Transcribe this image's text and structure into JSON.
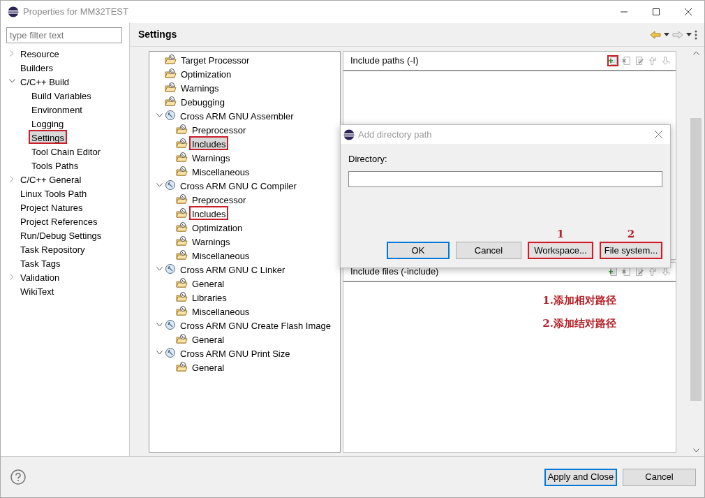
{
  "window": {
    "title": "Properties for MM32TEST"
  },
  "sidebar": {
    "filter_placeholder": "type filter text",
    "items": [
      {
        "label": "Resource",
        "expanded": false,
        "selected": false,
        "highlighted": false
      },
      {
        "label": "Builders",
        "selected": false,
        "highlighted": false
      },
      {
        "label": "C/C++ Build",
        "expanded": true,
        "selected": false,
        "highlighted": false,
        "children": [
          {
            "label": "Build Variables",
            "selected": false,
            "highlighted": false
          },
          {
            "label": "Environment",
            "selected": false,
            "highlighted": false
          },
          {
            "label": "Logging",
            "selected": false,
            "highlighted": false
          },
          {
            "label": "Settings",
            "selected": true,
            "highlighted": true
          },
          {
            "label": "Tool Chain Editor",
            "selected": false,
            "highlighted": false
          },
          {
            "label": "Tools Paths",
            "selected": false,
            "highlighted": false
          }
        ]
      },
      {
        "label": "C/C++ General",
        "expanded": false,
        "selected": false,
        "highlighted": false
      },
      {
        "label": "Linux Tools Path",
        "selected": false,
        "highlighted": false
      },
      {
        "label": "Project Natures",
        "selected": false,
        "highlighted": false
      },
      {
        "label": "Project References",
        "selected": false,
        "highlighted": false
      },
      {
        "label": "Run/Debug Settings",
        "selected": false,
        "highlighted": false
      },
      {
        "label": "Task Repository",
        "selected": false,
        "highlighted": false
      },
      {
        "label": "Task Tags",
        "selected": false,
        "highlighted": false
      },
      {
        "label": "Validation",
        "expanded": false,
        "selected": false,
        "highlighted": false
      },
      {
        "label": "WikiText",
        "selected": false,
        "highlighted": false
      }
    ]
  },
  "page": {
    "title": "Settings"
  },
  "tool_tree": [
    {
      "label": "Target Processor",
      "kind": "option",
      "selected": false,
      "highlighted": false
    },
    {
      "label": "Optimization",
      "kind": "option",
      "selected": false,
      "highlighted": false
    },
    {
      "label": "Warnings",
      "kind": "option",
      "selected": false,
      "highlighted": false
    },
    {
      "label": "Debugging",
      "kind": "option",
      "selected": false,
      "highlighted": false
    },
    {
      "label": "Cross ARM GNU Assembler",
      "kind": "tool",
      "expanded": true,
      "selected": false,
      "highlighted": false,
      "children": [
        {
          "label": "Preprocessor",
          "kind": "option",
          "selected": false,
          "highlighted": false
        },
        {
          "label": "Includes",
          "kind": "option",
          "selected": true,
          "highlighted": true
        },
        {
          "label": "Warnings",
          "kind": "option",
          "selected": false,
          "highlighted": false
        },
        {
          "label": "Miscellaneous",
          "kind": "option",
          "selected": false,
          "highlighted": false
        }
      ]
    },
    {
      "label": "Cross ARM GNU C Compiler",
      "kind": "tool",
      "expanded": true,
      "selected": false,
      "highlighted": false,
      "children": [
        {
          "label": "Preprocessor",
          "kind": "option",
          "selected": false,
          "highlighted": false
        },
        {
          "label": "Includes",
          "kind": "option",
          "selected": false,
          "highlighted": true
        },
        {
          "label": "Optimization",
          "kind": "option",
          "selected": false,
          "highlighted": false
        },
        {
          "label": "Warnings",
          "kind": "option",
          "selected": false,
          "highlighted": false
        },
        {
          "label": "Miscellaneous",
          "kind": "option",
          "selected": false,
          "highlighted": false
        }
      ]
    },
    {
      "label": "Cross ARM GNU C Linker",
      "kind": "tool",
      "expanded": true,
      "selected": false,
      "highlighted": false,
      "children": [
        {
          "label": "General",
          "kind": "option",
          "selected": false,
          "highlighted": false
        },
        {
          "label": "Libraries",
          "kind": "option",
          "selected": false,
          "highlighted": false
        },
        {
          "label": "Miscellaneous",
          "kind": "option",
          "selected": false,
          "highlighted": false
        }
      ]
    },
    {
      "label": "Cross ARM GNU Create Flash Image",
      "kind": "tool",
      "expanded": true,
      "selected": false,
      "highlighted": false,
      "children": [
        {
          "label": "General",
          "kind": "option",
          "selected": false,
          "highlighted": false
        }
      ]
    },
    {
      "label": "Cross ARM GNU Print Size",
      "kind": "tool",
      "expanded": true,
      "selected": false,
      "highlighted": false,
      "children": [
        {
          "label": "General",
          "kind": "option",
          "selected": false,
          "highlighted": false
        }
      ]
    }
  ],
  "sections": [
    {
      "title": "Include paths (-I)",
      "tools": [
        {
          "kind": "add",
          "highlighted": true
        },
        {
          "kind": "delete",
          "highlighted": false
        },
        {
          "kind": "edit",
          "highlighted": false
        },
        {
          "kind": "up",
          "highlighted": false
        },
        {
          "kind": "down",
          "highlighted": false
        }
      ]
    },
    {
      "title": "Include files (-include)",
      "tools": [
        {
          "kind": "add",
          "highlighted": false
        },
        {
          "kind": "delete",
          "highlighted": false
        },
        {
          "kind": "edit",
          "highlighted": false
        },
        {
          "kind": "up",
          "highlighted": false
        },
        {
          "kind": "down",
          "highlighted": false
        }
      ],
      "notes": [
        "1.添加相对路径",
        "2.添加结对路径"
      ]
    }
  ],
  "dialog": {
    "title": "Add directory path",
    "label": "Directory:",
    "buttons": [
      {
        "label": "OK",
        "default": true,
        "highlighted": false
      },
      {
        "label": "Cancel",
        "default": false,
        "highlighted": false
      },
      {
        "label": "Workspace...",
        "default": false,
        "highlighted": true,
        "marker": "1"
      },
      {
        "label": "File system...",
        "default": false,
        "highlighted": true,
        "marker": "2"
      }
    ]
  },
  "footer": {
    "buttons": [
      {
        "label": "Apply and Close",
        "default": true
      },
      {
        "label": "Cancel",
        "default": false
      }
    ]
  }
}
